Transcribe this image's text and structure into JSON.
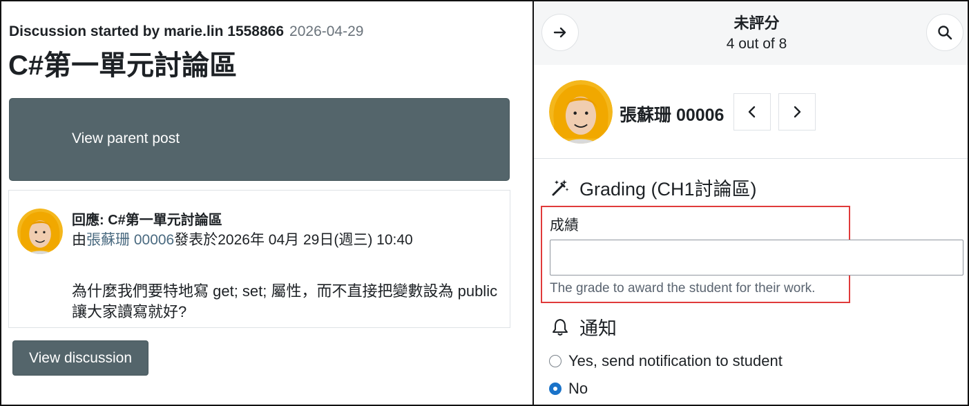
{
  "discussion": {
    "byline": "Discussion started by marie.lin 1558866",
    "date": "2026-04-29",
    "title": "C#第一單元討論區",
    "view_parent_label": "View parent post",
    "view_discussion_label": "View discussion"
  },
  "post": {
    "heading": "回應: C#第一單元討論區",
    "meta_prefix": "由",
    "author": "張蘇珊 00006",
    "meta_suffix": "發表於2026年 04月 29日(週三) 10:40",
    "body": "為什麼我們要特地寫 get; set; 屬性，而不直接把變數設為 public 讓大家讀寫就好?"
  },
  "grader": {
    "status": "未評分",
    "count": "4 out of 8",
    "user_name": "張蘇珊 00006",
    "grading_title": "Grading (CH1討論區)",
    "grade_label": "成績",
    "grade_value": "",
    "grade_help": "The grade to award the student for their work.",
    "notify_title": "通知",
    "notify_options": [
      {
        "label": "Yes, send notification to student",
        "selected": false
      },
      {
        "label": "No",
        "selected": true
      }
    ]
  },
  "icons": {
    "collapse": "arrow-right-icon",
    "search": "search-icon",
    "prev": "chevron-left-icon",
    "next": "chevron-right-icon",
    "grading": "magic-wand-icon",
    "notify": "bell-icon"
  },
  "colors": {
    "button_bg": "#54656b",
    "highlight": "#e03a3a",
    "radio_selected": "#1a73c9",
    "link": "#4a6a80"
  }
}
